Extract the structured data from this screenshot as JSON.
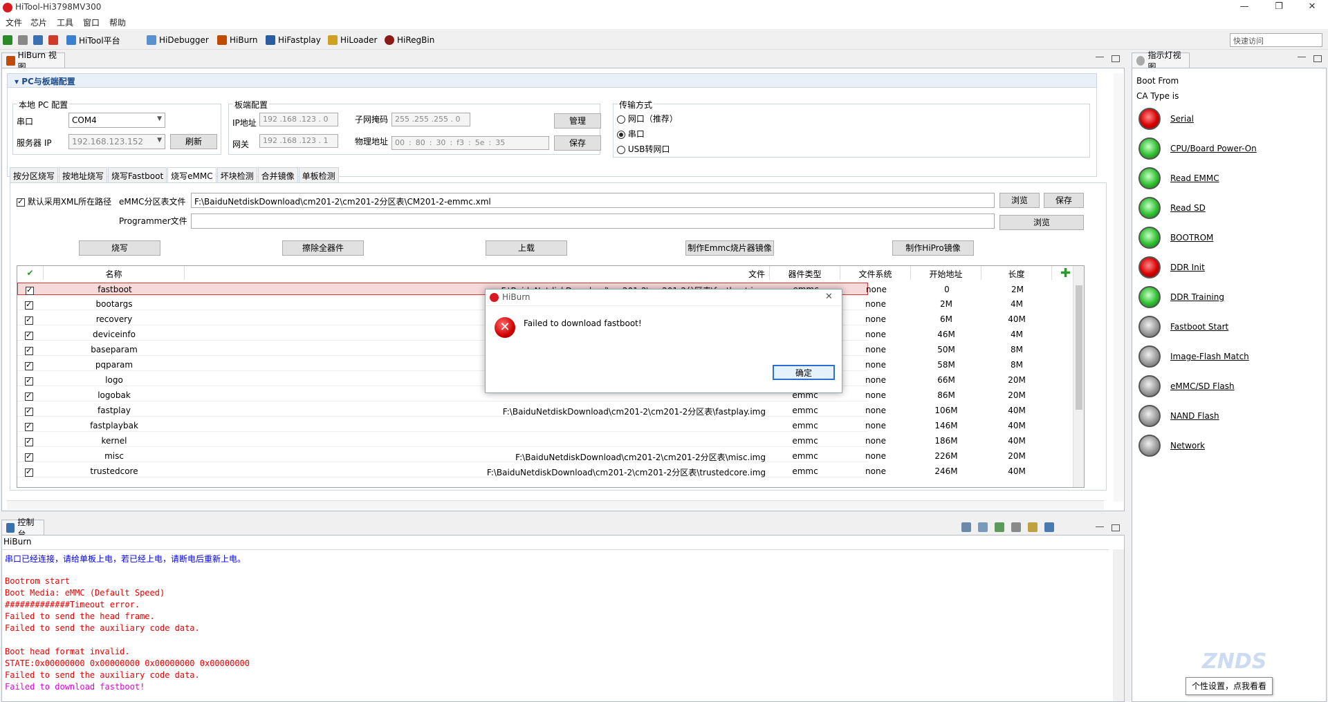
{
  "window": {
    "title": "HiTool-Hi3798MV300",
    "controls": {
      "minimize": "—",
      "restore": "❐",
      "close": "✕"
    }
  },
  "menu": [
    "文件",
    "芯片",
    "工具",
    "窗口",
    "帮助"
  ],
  "toolbar": {
    "items": [
      "HiTool平台",
      "HiDebugger",
      "HiBurn",
      "HiFastplay",
      "HiLoader",
      "HiRegBin"
    ],
    "quick_access_placeholder": "快速访问"
  },
  "hiburn_view": {
    "tab_label": "HiBurn 视图",
    "section_title": "PC与板端配置",
    "local_pc": {
      "title": "本地 PC 配置",
      "port_label": "串口",
      "port_value": "COM4",
      "server_ip_label": "服务器 IP",
      "server_ip_value": "192.168.123.152",
      "refresh_button": "刷新"
    },
    "board": {
      "title": "板端配置",
      "ip_label": "IP地址",
      "ip_value": "192 .168 .123 .  0",
      "gateway_label": "网关",
      "gateway_value": "192 .168 .123 .  1",
      "subnet_label": "子网掩码",
      "subnet_value": "255 .255 .255 .  0",
      "mac_label": "物理地址",
      "mac_values": [
        "00",
        "80",
        "30",
        "f3",
        "5e",
        "35"
      ],
      "manage_button": "管理",
      "save_button": "保存"
    },
    "transfer": {
      "title": "传输方式",
      "options": [
        "网口（推荐）",
        "串口",
        "USB转网口"
      ],
      "selected_index": 1
    },
    "tabs": [
      "按分区烧写",
      "按地址烧写",
      "烧写Fastboot",
      "烧写eMMC",
      "坏块检测",
      "合并镜像",
      "单板检测"
    ],
    "active_tab_index": 3,
    "default_xml_label": "默认采用XML所在路径",
    "emmc_table_label": "eMMC分区表文件",
    "emmc_table_path": "F:\\BaiduNetdiskDownload\\cm201-2\\cm201-2分区表\\CM201-2-emmc.xml",
    "browse_button": "浏览",
    "save_button": "保存",
    "programmer_label": "Programmer文件",
    "programmer_value": "",
    "browse_button2": "浏览",
    "actions": [
      "烧写",
      "擦除全器件",
      "上载",
      "制作Emmc烧片器镜像",
      "制作HiPro镜像"
    ],
    "table": {
      "headers": [
        "名称",
        "文件",
        "器件类型",
        "文件系统",
        "开始地址",
        "长度"
      ],
      "rows": [
        {
          "name": "fastboot",
          "file": "F:\\BaiduNetdiskDownload\\cm201-2\\cm201-2分区表\\fastboot.img",
          "type": "emmc",
          "fs": "none",
          "start": "0",
          "length": "2M"
        },
        {
          "name": "bootargs",
          "file": "",
          "type": "emmc",
          "fs": "none",
          "start": "2M",
          "length": "4M"
        },
        {
          "name": "recovery",
          "file": "",
          "type": "emmc",
          "fs": "none",
          "start": "6M",
          "length": "40M"
        },
        {
          "name": "deviceinfo",
          "file": "",
          "type": "emmc",
          "fs": "none",
          "start": "46M",
          "length": "4M"
        },
        {
          "name": "baseparam",
          "file": "F:\\",
          "type": "emmc",
          "fs": "none",
          "start": "50M",
          "length": "8M"
        },
        {
          "name": "pqparam",
          "file": "F",
          "type": "emmc",
          "fs": "none",
          "start": "58M",
          "length": "8M"
        },
        {
          "name": "logo",
          "file": "",
          "type": "emmc",
          "fs": "none",
          "start": "66M",
          "length": "20M"
        },
        {
          "name": "logobak",
          "file": "",
          "type": "emmc",
          "fs": "none",
          "start": "86M",
          "length": "20M"
        },
        {
          "name": "fastplay",
          "file": "F:\\BaiduNetdiskDownload\\cm201-2\\cm201-2分区表\\fastplay.img",
          "type": "emmc",
          "fs": "none",
          "start": "106M",
          "length": "40M"
        },
        {
          "name": "fastplaybak",
          "file": "",
          "type": "emmc",
          "fs": "none",
          "start": "146M",
          "length": "40M"
        },
        {
          "name": "kernel",
          "file": "",
          "type": "emmc",
          "fs": "none",
          "start": "186M",
          "length": "40M"
        },
        {
          "name": "misc",
          "file": "F:\\BaiduNetdiskDownload\\cm201-2\\cm201-2分区表\\misc.img",
          "type": "emmc",
          "fs": "none",
          "start": "226M",
          "length": "20M"
        },
        {
          "name": "trustedcore",
          "file": "F:\\BaiduNetdiskDownload\\cm201-2\\cm201-2分区表\\trustedcore.img",
          "type": "emmc",
          "fs": "none",
          "start": "246M",
          "length": "40M"
        }
      ]
    }
  },
  "dialog": {
    "title": "HiBurn",
    "message": "Failed to download fastboot!",
    "ok_button": "确定",
    "close": "✕"
  },
  "console": {
    "tab_label": "控制台",
    "source": "HiBurn",
    "lines": [
      {
        "text": "串口已经连接，请给单板上电，若已经上电，请断电后重新上电。",
        "color": "#0000ee"
      },
      {
        "text": "",
        "color": "#000000"
      },
      {
        "text": "Bootrom start",
        "color": "#ee0000"
      },
      {
        "text": "Boot Media: eMMC (Default Speed)",
        "color": "#ee0000"
      },
      {
        "text": "#############Timeout error.",
        "color": "#ee0000"
      },
      {
        "text": "Failed to send the head frame.",
        "color": "#ee0000"
      },
      {
        "text": "Failed to send the auxiliary code data.",
        "color": "#ee0000"
      },
      {
        "text": "",
        "color": "#000000"
      },
      {
        "text": "Boot head format invalid.",
        "color": "#ee0000"
      },
      {
        "text": "STATE:0x00000000 0x00000000 0x00000000 0x00000000",
        "color": "#ee0000"
      },
      {
        "text": "Failed to send the auxiliary code data.",
        "color": "#ee0000"
      },
      {
        "text": "Failed to download fastboot!",
        "color": "#e000e0"
      }
    ]
  },
  "indicator_view": {
    "tab_label": "指示灯视图",
    "boot_from": "Boot From",
    "ca_type": "CA Type is",
    "indicators": [
      {
        "label": "Serial",
        "state": "red"
      },
      {
        "label": "CPU/Board Power-On",
        "state": "green"
      },
      {
        "label": "Read EMMC",
        "state": "green"
      },
      {
        "label": "Read SD",
        "state": "green"
      },
      {
        "label": "BOOTROM",
        "state": "green"
      },
      {
        "label": "DDR Init",
        "state": "red"
      },
      {
        "label": "DDR Training",
        "state": "green"
      },
      {
        "label": "Fastboot Start",
        "state": "gray"
      },
      {
        "label": "Image-Flash Match",
        "state": "gray"
      },
      {
        "label": "eMMC/SD Flash",
        "state": "gray"
      },
      {
        "label": "NAND Flash",
        "state": "gray"
      },
      {
        "label": "Network",
        "state": "gray"
      }
    ]
  },
  "tooltip": "个性设置，点我看看",
  "watermark": "ZNDS"
}
